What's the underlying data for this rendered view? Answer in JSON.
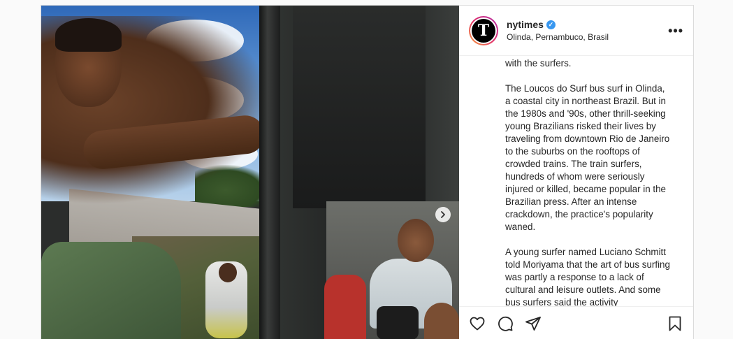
{
  "account": {
    "username": "nytimes",
    "verified_mark": "✓",
    "location": "Olinda, Pernambuco, Brasil",
    "avatar_letter": "T"
  },
  "menu": {
    "more_label": "•••"
  },
  "caption": {
    "paragraphs": [
      "with the surfers.",
      "The Loucos do Surf bus surf in Olinda, a coastal city in northeast Brazil. But in the 1980s and '90s, other thrill-seeking young Brazilians risked their lives by traveling from downtown Rio de Janeiro to the suburbs on the rooftops of crowded trains. The train surfers, hundreds of whom were seriously injured or killed, became popular in the Brazilian press. After an intense crackdown, the practice's popularity waned.",
      "A young surfer named Luciano Schmitt told Moriyama that the art of bus surfing was partly a response to a lack of cultural and leisure outlets. And some bus surfers said the activity"
    ]
  },
  "icons": {
    "like": "heart-icon",
    "comment": "comment-icon",
    "share": "paper-plane-icon",
    "save": "bookmark-icon",
    "next": "chevron-right-icon"
  },
  "colors": {
    "verified": "#3897f0",
    "text": "#262626",
    "border": "#dbdbdb"
  }
}
